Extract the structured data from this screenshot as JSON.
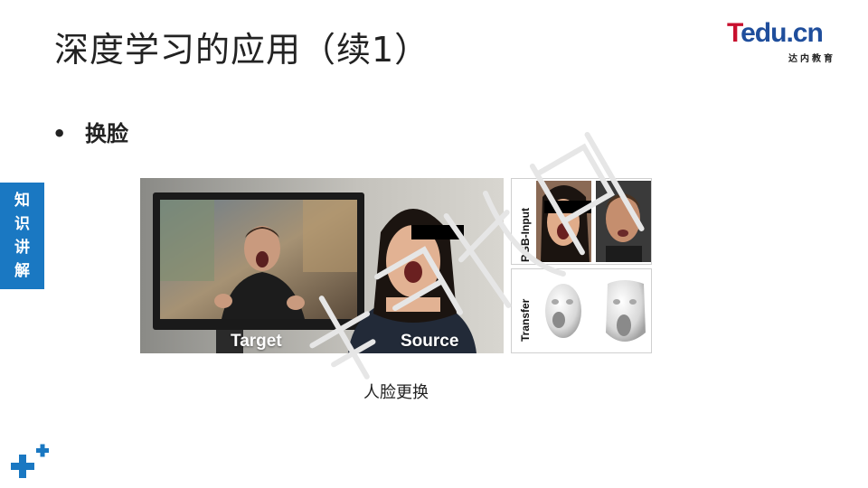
{
  "slide": {
    "title": "深度学习的应用（续1）",
    "bullet": "换脸",
    "side_tab": [
      "知",
      "识",
      "讲",
      "解"
    ],
    "caption": "人脸更换"
  },
  "logo": {
    "initial": "T",
    "rest": "edu.cn",
    "subtitle": "达内教育"
  },
  "figure": {
    "target_label": "Target",
    "source_label": "Source",
    "rgb_label": "RGB-Input",
    "transfer_label": "Transfer"
  },
  "colors": {
    "accent_blue": "#1a78c2",
    "logo_red": "#c8102e",
    "logo_blue": "#1f4e9c"
  }
}
